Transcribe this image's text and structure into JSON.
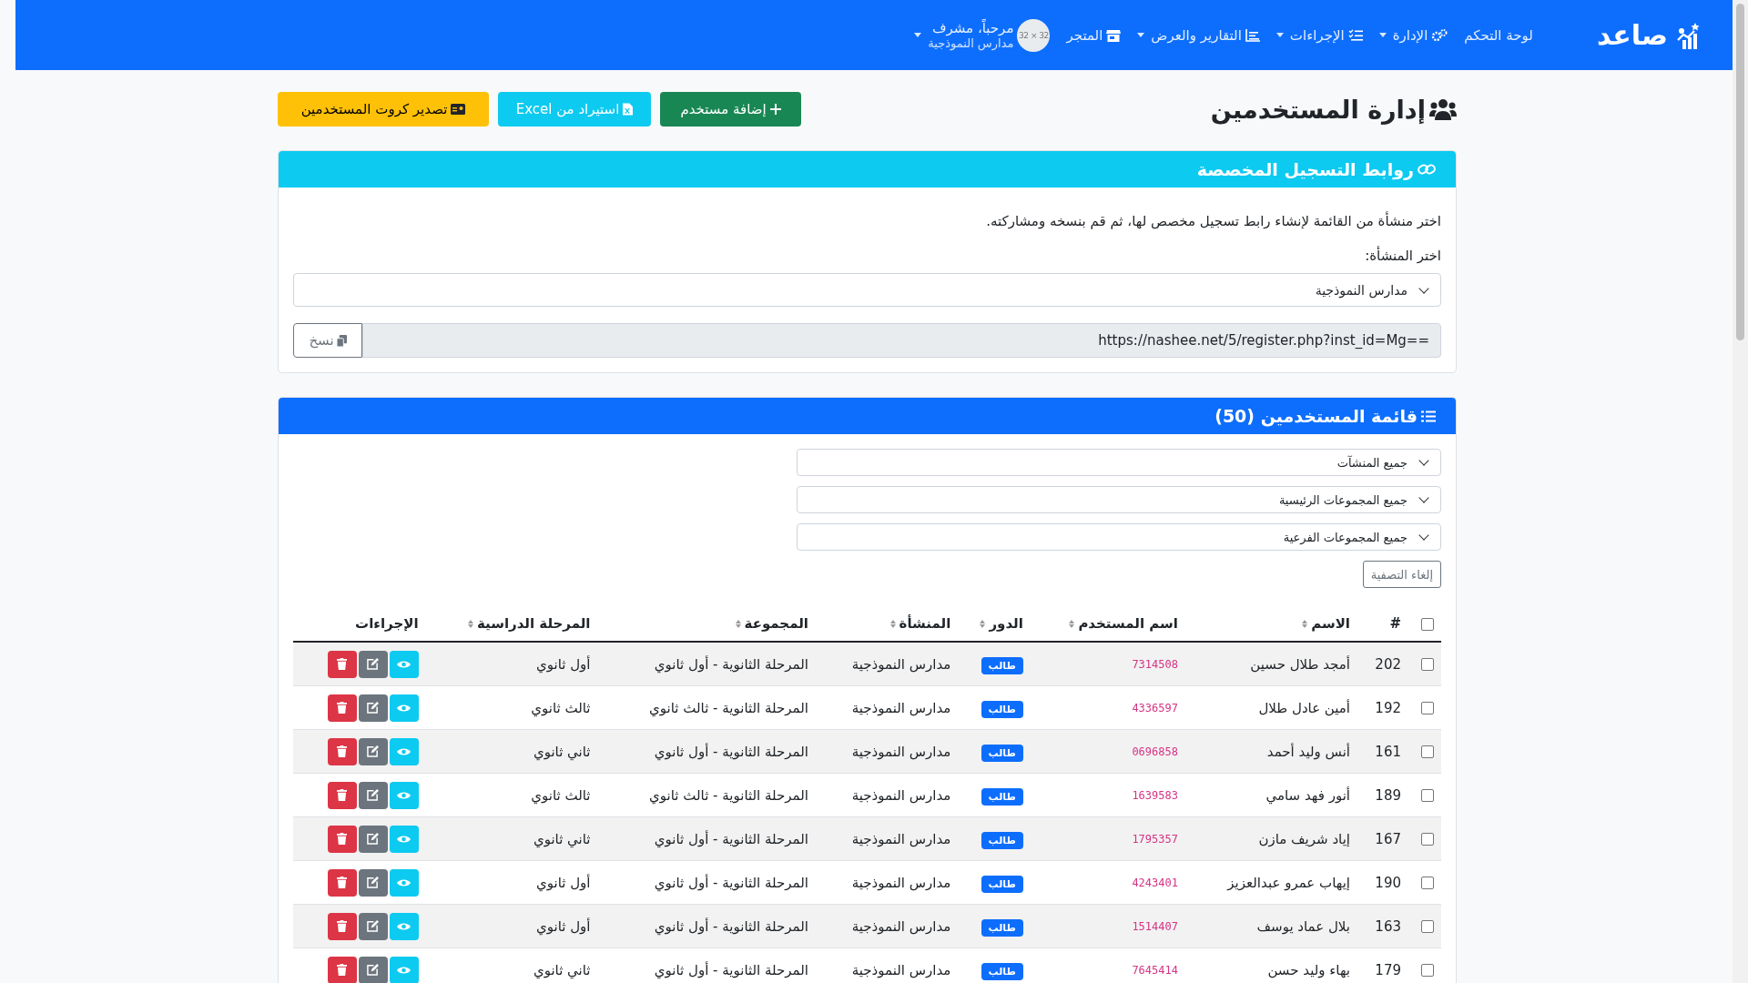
{
  "navbar": {
    "brand": "صاعد",
    "items": [
      {
        "label": "لوحة التحكم",
        "kind": "plain",
        "dropdown": false
      },
      {
        "label": "الإدارة",
        "kind": "gears",
        "dropdown": true
      },
      {
        "label": "الإجراءات",
        "kind": "checklist",
        "dropdown": true
      },
      {
        "label": "التقارير والعرض",
        "kind": "chart",
        "dropdown": true
      },
      {
        "label": "المتجر",
        "kind": "store",
        "dropdown": false
      }
    ],
    "user": {
      "avatar_text": "32 × 32",
      "greeting": "مرحباً، مشرف",
      "org": "مدارس النموذجية"
    }
  },
  "page": {
    "title": "إدارة المستخدمين",
    "buttons": [
      {
        "label": "إضافة مستخدم",
        "kind": "success"
      },
      {
        "label": "استيراد من Excel",
        "kind": "info"
      },
      {
        "label": "تصدير كروت المستخدمين",
        "kind": "warning"
      }
    ]
  },
  "links_card": {
    "title": "روابط التسجيل المخصصة",
    "description": "اختر منشأة من القائمة لإنشاء رابط تسجيل مخصص لها، ثم قم بنسخه ومشاركته.",
    "select_label": "اختر المنشأة:",
    "select_value": "مدارس النموذجية",
    "url": "https://nashee.net/5/register.php?inst_id=Mg==",
    "copy_label": "نسخ"
  },
  "users_card": {
    "title": "قائمة المستخدمين (50)",
    "filters": [
      "جميع المنشآت",
      "جميع المجموعات الرئيسية",
      "جميع المجموعات الفرعية"
    ],
    "clear_label": "إلغاء التصفية",
    "select_all_checked": false,
    "columns": [
      {
        "label": "#",
        "sortable": false
      },
      {
        "label": "الاسم",
        "sortable": true
      },
      {
        "label": "اسم المستخدم",
        "sortable": true
      },
      {
        "label": "الدور",
        "sortable": true
      },
      {
        "label": "المنشأة",
        "sortable": true
      },
      {
        "label": "المجموعة",
        "sortable": true
      },
      {
        "label": "المرحلة الدراسية",
        "sortable": true
      },
      {
        "label": "الإجراءات",
        "sortable": false
      }
    ],
    "row_actions": [
      {
        "kind": "view"
      },
      {
        "kind": "edit"
      },
      {
        "kind": "delete"
      }
    ],
    "rows": [
      {
        "checked": false,
        "id": "202",
        "name": "أمجد طلال حسين",
        "username": "7314508",
        "role": "طالب",
        "org": "مدارس النموذجية",
        "group": "المرحلة الثانوية - أول ثانوي",
        "stage": "أول ثانوي"
      },
      {
        "checked": false,
        "id": "192",
        "name": "أمين عادل طلال",
        "username": "4336597",
        "role": "طالب",
        "org": "مدارس النموذجية",
        "group": "المرحلة الثانوية - ثالث ثانوي",
        "stage": "ثالث ثانوي"
      },
      {
        "checked": false,
        "id": "161",
        "name": "أنس وليد أحمد",
        "username": "0696858",
        "role": "طالب",
        "org": "مدارس النموذجية",
        "group": "المرحلة الثانوية - أول ثانوي",
        "stage": "ثاني ثانوي"
      },
      {
        "checked": false,
        "id": "189",
        "name": "أنور فهد سامي",
        "username": "1639583",
        "role": "طالب",
        "org": "مدارس النموذجية",
        "group": "المرحلة الثانوية - ثالث ثانوي",
        "stage": "ثالث ثانوي"
      },
      {
        "checked": false,
        "id": "167",
        "name": "إياد شريف مازن",
        "username": "1795357",
        "role": "طالب",
        "org": "مدارس النموذجية",
        "group": "المرحلة الثانوية - أول ثانوي",
        "stage": "ثاني ثانوي"
      },
      {
        "checked": false,
        "id": "190",
        "name": "إيهاب عمرو عبدالعزيز",
        "username": "4243401",
        "role": "طالب",
        "org": "مدارس النموذجية",
        "group": "المرحلة الثانوية - أول ثانوي",
        "stage": "أول ثانوي"
      },
      {
        "checked": false,
        "id": "163",
        "name": "بلال عماد يوسف",
        "username": "1514407",
        "role": "طالب",
        "org": "مدارس النموذجية",
        "group": "المرحلة الثانوية - أول ثانوي",
        "stage": "أول ثانوي"
      },
      {
        "checked": false,
        "id": "179",
        "name": "بهاء وليد حسن",
        "username": "7645414",
        "role": "طالب",
        "org": "مدارس النموذجية",
        "group": "المرحلة الثانوية - أول ثانوي",
        "stage": "ثاني ثانوي"
      }
    ]
  }
}
